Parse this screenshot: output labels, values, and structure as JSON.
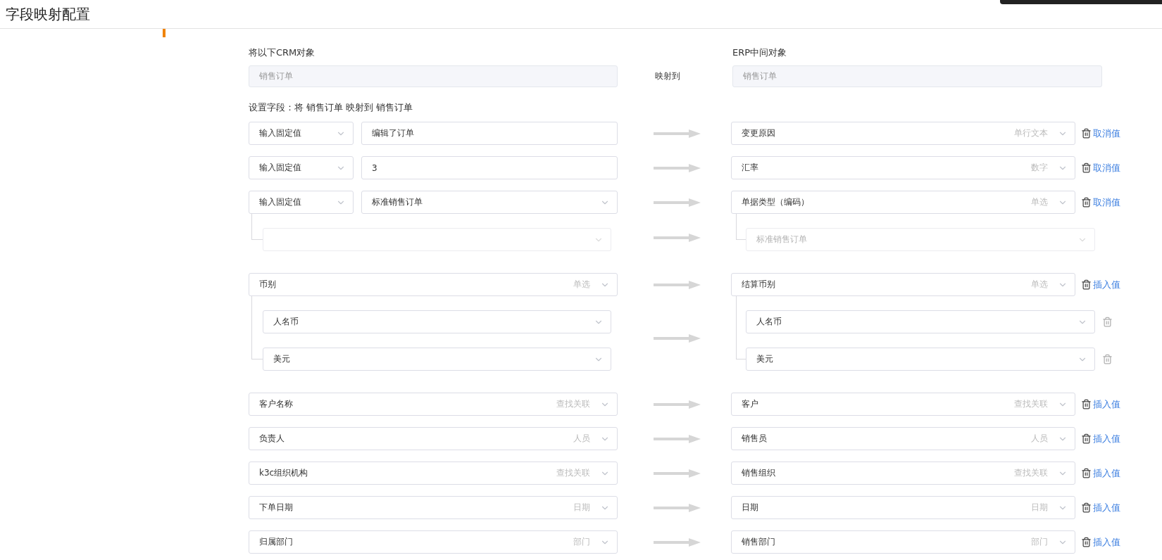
{
  "page": {
    "title": "字段映射配置"
  },
  "source_object": {
    "label": "将以下CRM对象",
    "value": "销售订单"
  },
  "maps_to": "映射到",
  "target_object": {
    "label": "ERP中间对象",
    "value": "销售订单"
  },
  "summary": "设置字段：将 销售订单 映射到 销售订单",
  "mappings": [
    {
      "kind": "fixed_text",
      "mode": "输入固定值",
      "value": "编辑了订单",
      "target": {
        "name": "变更原因",
        "type": "单行文本"
      },
      "action": "取消值"
    },
    {
      "kind": "fixed_text",
      "mode": "输入固定值",
      "value": "3",
      "target": {
        "name": "汇率",
        "type": "数字"
      },
      "action": "取消值"
    },
    {
      "kind": "fixed_select",
      "mode": "输入固定值",
      "value": "标准销售订单",
      "target": {
        "name": "单据类型（编码）",
        "type": "单选"
      },
      "action": "取消值",
      "options": [
        {
          "target": "标准销售订单",
          "disabled": true
        }
      ]
    },
    {
      "kind": "field",
      "source": {
        "name": "币别",
        "type": "单选"
      },
      "target": {
        "name": "结算币别",
        "type": "单选"
      },
      "action": "插入值",
      "options": [
        {
          "source": "人名币",
          "target": "人名币",
          "disabled": false
        },
        {
          "source": "美元",
          "target": "美元",
          "disabled": false
        }
      ]
    },
    {
      "kind": "field",
      "source": {
        "name": "客户名称",
        "type": "查找关联"
      },
      "target": {
        "name": "客户",
        "type": "查找关联"
      },
      "action": "插入值"
    },
    {
      "kind": "field",
      "source": {
        "name": "负责人",
        "type": "人员"
      },
      "target": {
        "name": "销售员",
        "type": "人员"
      },
      "action": "插入值"
    },
    {
      "kind": "field",
      "source": {
        "name": "k3c组织机构",
        "type": "查找关联"
      },
      "target": {
        "name": "销售组织",
        "type": "查找关联"
      },
      "action": "插入值"
    },
    {
      "kind": "field",
      "source": {
        "name": "下单日期",
        "type": "日期"
      },
      "target": {
        "name": "日期",
        "type": "日期"
      },
      "action": "插入值"
    },
    {
      "kind": "field",
      "source": {
        "name": "归属部门",
        "type": "部门"
      },
      "target": {
        "name": "销售部门",
        "type": "部门"
      },
      "action": "插入值"
    }
  ]
}
